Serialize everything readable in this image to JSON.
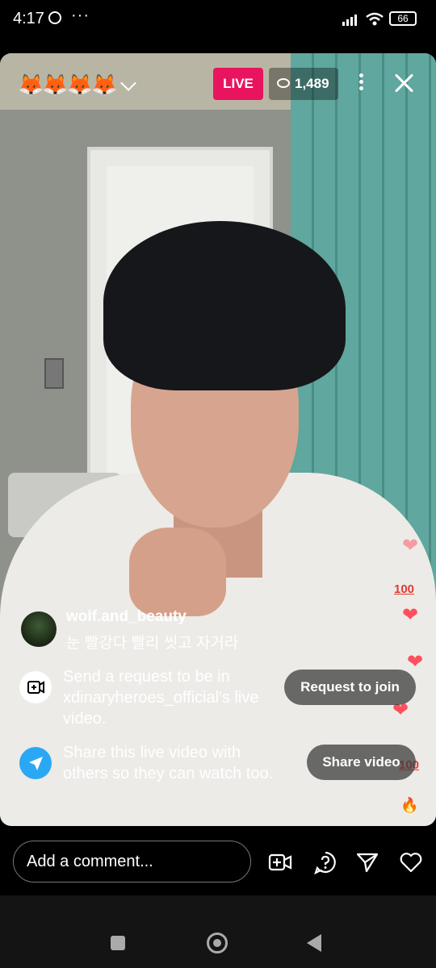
{
  "status_bar": {
    "time": "4:17",
    "overflow": "···",
    "battery": "66"
  },
  "broadcast": {
    "emoji_row": "🦊🦊🦊🦊",
    "live_label": "LIVE",
    "viewer_count": "1,489"
  },
  "comments": [
    {
      "username": "wolf.and_beauty",
      "text": "눈 빨강다 빨리 씻고 자거라"
    }
  ],
  "notices": {
    "request": {
      "text": "Send a request to be in xdinaryheroes_official's live video.",
      "button_label": "Request to join"
    },
    "share": {
      "text": "Share this live video with others so they can watch too.",
      "button_label": "Share video"
    }
  },
  "reactions": {
    "heart": "❤",
    "hundred": "100",
    "fire": "🔥"
  },
  "bottom_bar": {
    "comment_placeholder": "Add a comment..."
  },
  "colors": {
    "live_badge": "#e8155e",
    "share_icon": "#2ba8f4",
    "reaction_heart": "#ff4f5e"
  }
}
